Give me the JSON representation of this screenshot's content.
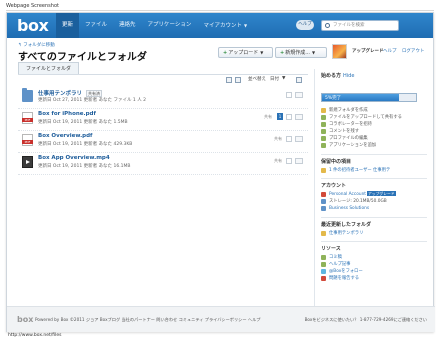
{
  "screenshot": {
    "title": "Webpage Screenshot",
    "url": "http://www.box.net/files"
  },
  "header": {
    "logo": "box",
    "nav": [
      {
        "label": "更新",
        "active": true
      },
      {
        "label": "ファイル",
        "active": false
      },
      {
        "label": "連絡先",
        "active": false
      },
      {
        "label": "アプリケーション",
        "active": false
      },
      {
        "label": "マイアカウント",
        "active": false,
        "dropdown": true
      }
    ],
    "help_label": "ヘルプ",
    "search_placeholder": "ファイルを検索"
  },
  "page": {
    "breadcrumb": "フォルダに移動",
    "title": "すべてのファイルとフォルダ",
    "tab": "ファイルとフォルダ",
    "upload_label": "アップロード",
    "new_label": "新規作成..."
  },
  "account": {
    "upgrade_label": "アップグレード",
    "links": [
      "ヘルプ",
      "ログアウト"
    ]
  },
  "toolbar": {
    "sort_label": "並べ替え",
    "sort_value": "日付"
  },
  "files": [
    {
      "name": "仕事用テンポラリ",
      "tag": "共有済",
      "meta": "更新日 Oct 27, 2011 更新者 あなた  ファイル  1  人  2",
      "type": "folder",
      "share": ""
    },
    {
      "name": "Box for iPhone.pdf",
      "tag": "",
      "meta": "更新日 Oct 19, 2011 更新者 あなた  1.5MB",
      "type": "pdf",
      "share": "共有",
      "badge": "1"
    },
    {
      "name": "Box Overview.pdf",
      "tag": "",
      "meta": "更新日 Oct 19, 2011 更新者 あなた  429.3KB",
      "type": "pdf",
      "share": "共有"
    },
    {
      "name": "Box App Overview.mp4",
      "tag": "",
      "meta": "更新日 Oct 19, 2011 更新者 あなた  16.1MB",
      "type": "video",
      "share": "共有"
    }
  ],
  "sidebar": {
    "tips_heading": "始める方",
    "tips_hide": "Hide",
    "progress_label": "5%完了",
    "progress_fraction": 0.05,
    "tips": [
      "新規フォルダを作成",
      "ファイルをアップロードして共有する",
      "コラボレーターを招待",
      "コメントを残す",
      "プロファイルの編集",
      "アプリケーションを追加"
    ],
    "waiting_heading": "保留中の項目",
    "waiting_item": "1 件の招待者ユーザー  仕事用テ",
    "account_heading": "アカウント",
    "account_plan": "Personal Account",
    "account_upgrade": "アップグレード",
    "storage": "ストレージ: 20.1MB/50.0GB",
    "business": "Business Solutions",
    "recent_heading": "最近更新したフォルダ",
    "recent_item": "仕事用テンポラリ",
    "resources_heading": "リソース",
    "resources": [
      "コミ稿",
      "ヘルプ記事",
      "@Boxをフォロー",
      "問題を報告する"
    ]
  },
  "footer": {
    "logo": "box",
    "links": "Powered by Box  ©2011 ジョア  Boxブログ  当社のパートナー  問い合わせ  コミュニティ  プライバシーポリシー  ヘルプ",
    "right": "Boxをビジネスに使いたい？ 1-877-729-4269にご連絡ください"
  },
  "colors": {
    "brand": "#2f86cc",
    "link": "#2a72b6",
    "pdf_red": "#c9302c"
  }
}
